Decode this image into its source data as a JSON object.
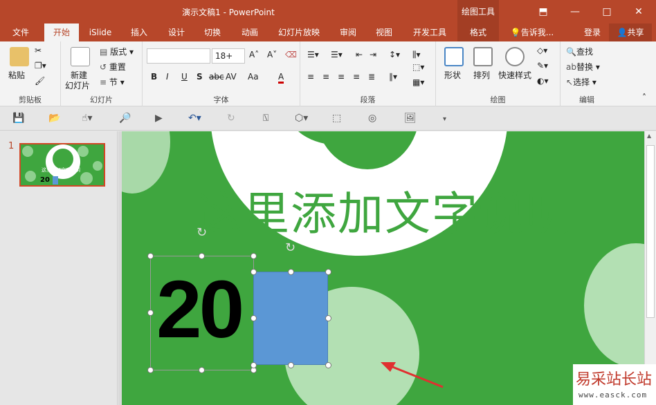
{
  "window": {
    "title": "演示文稿1 - PowerPoint",
    "context_tab_group": "绘图工具"
  },
  "tabs": {
    "file": "文件",
    "home": "开始",
    "islide": "iSlide",
    "insert": "插入",
    "design": "设计",
    "transitions": "切换",
    "animations": "动画",
    "slideshow": "幻灯片放映",
    "review": "审阅",
    "view": "视图",
    "developer": "开发工具",
    "format": "格式",
    "tellme": "告诉我...",
    "signin": "登录",
    "share": "共享"
  },
  "ribbon": {
    "clipboard": {
      "label": "剪贴板",
      "paste": "粘贴"
    },
    "slides": {
      "label": "幻灯片",
      "new_slide": "新建",
      "new_slide2": "幻灯片",
      "layout": "版式",
      "reset": "重置",
      "section": "节"
    },
    "font": {
      "label": "字体",
      "font_name": "",
      "font_size": "18+",
      "bold": "B",
      "italic": "I",
      "underline": "U",
      "shadow": "S",
      "strike": "abc",
      "spacing": "AV",
      "case": "Aa",
      "color": "A"
    },
    "paragraph": {
      "label": "段落"
    },
    "drawing": {
      "label": "绘图",
      "shapes": "形状",
      "arrange": "排列",
      "quick_styles": "快速样式"
    },
    "editing": {
      "label": "编辑",
      "find": "查找",
      "replace": "替换",
      "select": "选择"
    }
  },
  "slides_pane": {
    "slide_number": "1",
    "thumb_text": "这里添加文字说明",
    "thumb_number": "20"
  },
  "slide": {
    "title": "这里添加文字说明",
    "number_text": "20",
    "bg_color": "#3fa63f",
    "rect_color": "#5b97d5"
  },
  "watermark": {
    "text": "易采站长站",
    "url": "www.easck.com"
  }
}
